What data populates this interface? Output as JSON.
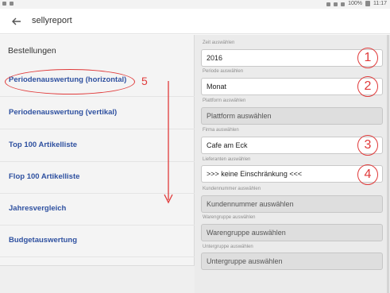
{
  "status_bar": {
    "battery": "100%",
    "time": "11:17"
  },
  "app_bar": {
    "title": "sellyreport"
  },
  "left": {
    "section_title": "Bestellungen",
    "items": [
      {
        "label": "Periodenauswertung (horizontal)"
      },
      {
        "label": "Periodenauswertung (vertikal)"
      },
      {
        "label": "Top 100 Artikelliste"
      },
      {
        "label": "Flop 100 Artikelliste"
      },
      {
        "label": "Jahresvergleich"
      },
      {
        "label": "Budgetauswertung"
      }
    ]
  },
  "annotations": {
    "n1": "1",
    "n2": "2",
    "n3": "3",
    "n4": "4",
    "n5": "5",
    "color": "#e03a3a"
  },
  "right": {
    "fields": [
      {
        "label": "Zeit auswählen",
        "value": "2016",
        "disabled": false
      },
      {
        "label": "Periode auswählen",
        "value": "Monat",
        "disabled": false
      },
      {
        "label": "Plattform auswählen",
        "value": "Plattform auswählen",
        "disabled": true
      },
      {
        "label": "Firma auswählen",
        "value": "Cafe am Eck",
        "disabled": false
      },
      {
        "label": "Lieferanten auswählen",
        "value": ">>> keine Einschränkung <<<",
        "disabled": false
      },
      {
        "label": "Kundennummer auswählen",
        "value": "Kundennummer auswählen",
        "disabled": true
      },
      {
        "label": "Warengruppe auswählen",
        "value": "Warengruppe auswählen",
        "disabled": true
      },
      {
        "label": "Untergruppe auswählen",
        "value": "Untergruppe auswählen",
        "disabled": true
      }
    ]
  },
  "colors": {
    "accent_text": "#2f51a0",
    "annotation": "#e03a3a"
  }
}
